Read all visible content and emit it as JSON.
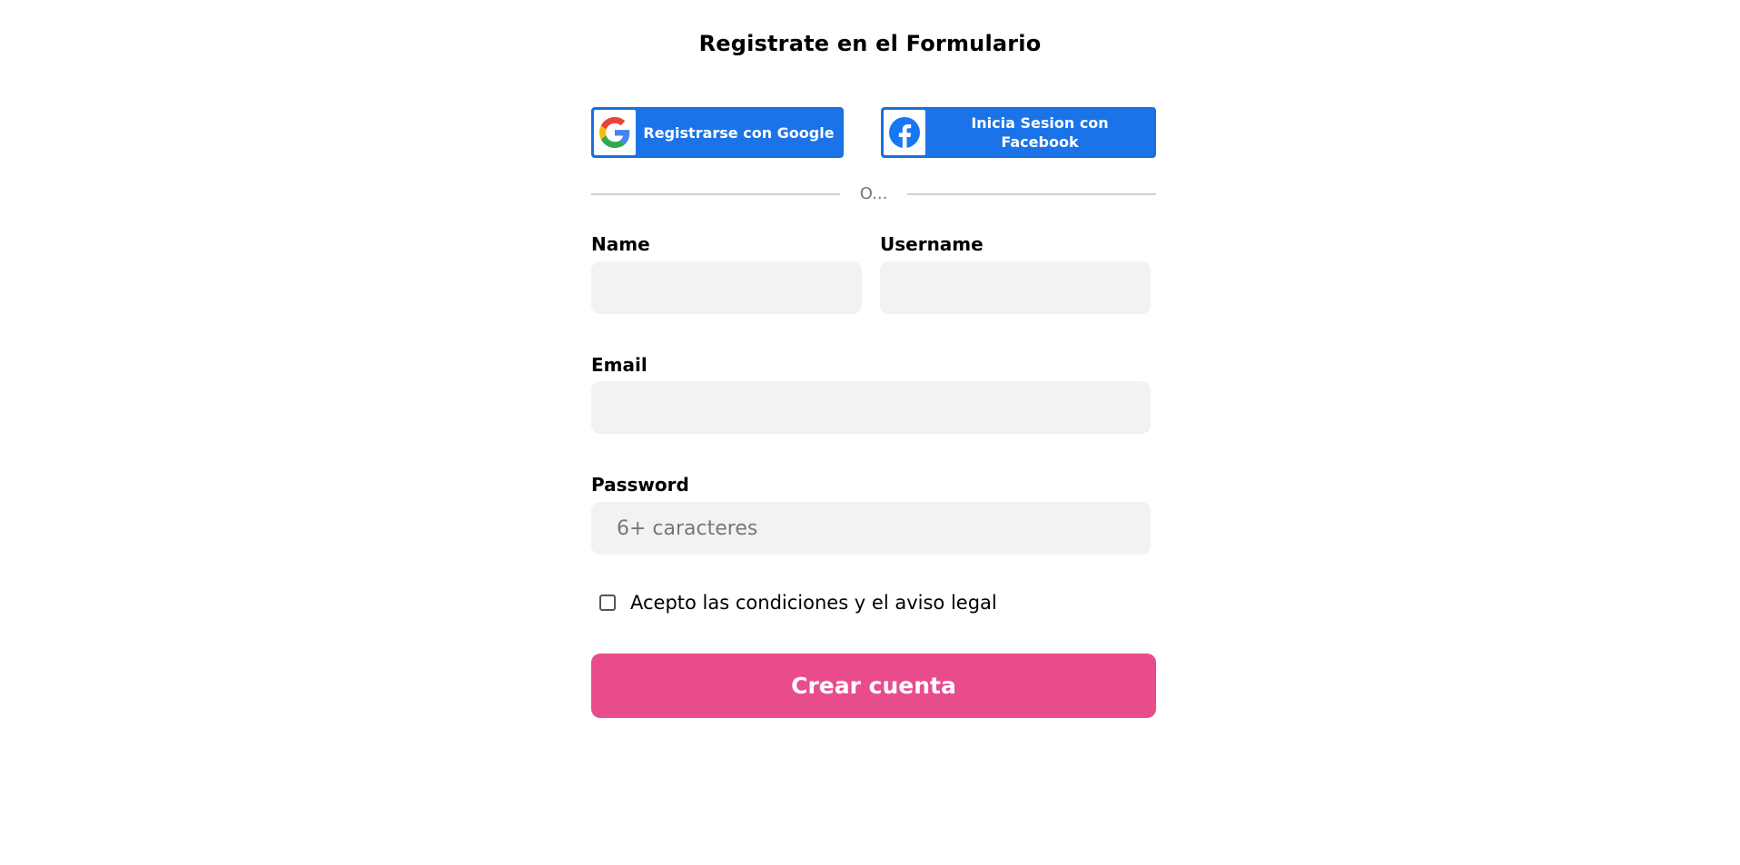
{
  "form": {
    "title": "Registrate en el Formulario",
    "social": {
      "google_label": "Registrarse con Google",
      "facebook_label": "Inicia Sesion con Facebook"
    },
    "divider_text": "O...",
    "fields": {
      "name_label": "Name",
      "username_label": "Username",
      "email_label": "Email",
      "password_label": "Password",
      "password_placeholder": "6+ caracteres"
    },
    "terms_label": "Acepto las condiciones y el aviso legal",
    "submit_label": "Crear cuenta"
  },
  "icons": {
    "google": "google-icon",
    "facebook": "facebook-icon"
  },
  "colors": {
    "social_button": "#1a73e8",
    "submit_button": "#e84c8b",
    "input_background": "#f2f2f3"
  }
}
